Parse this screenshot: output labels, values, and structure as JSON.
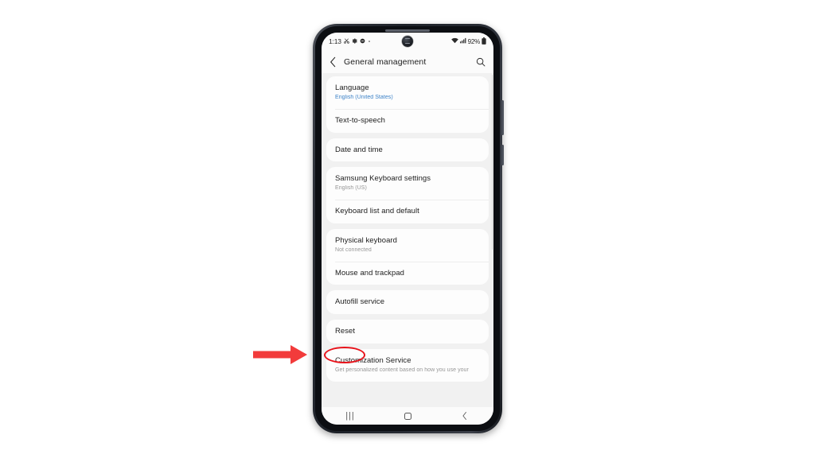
{
  "device": {
    "name": "samsung-galaxy-phone",
    "frame_color": "#2c3038"
  },
  "statusbar": {
    "clock": "1:13",
    "left_icons": [
      "scissors-icon",
      "gear-icon",
      "do-not-disturb-icon",
      "dot-icon"
    ],
    "right_icons": [
      "wifi-icon",
      "cellular-signal-icon"
    ],
    "battery_text": "92%",
    "battery_icon": "battery-full-icon"
  },
  "appbar": {
    "back_icon": "chevron-left-icon",
    "title": "General management",
    "search_icon": "search-icon"
  },
  "settings": {
    "groups": [
      {
        "rows": [
          {
            "title": "Language",
            "sub": "English (United States)",
            "sub_style": "accent"
          },
          {
            "title": "Text-to-speech",
            "sub": ""
          }
        ]
      },
      {
        "rows": [
          {
            "title": "Date and time",
            "sub": ""
          }
        ]
      },
      {
        "rows": [
          {
            "title": "Samsung Keyboard settings",
            "sub": "English (US)",
            "sub_style": "muted"
          },
          {
            "title": "Keyboard list and default",
            "sub": ""
          }
        ]
      },
      {
        "rows": [
          {
            "title": "Physical keyboard",
            "sub": "Not connected",
            "sub_style": "muted"
          },
          {
            "title": "Mouse and trackpad",
            "sub": ""
          }
        ]
      },
      {
        "rows": [
          {
            "title": "Autofill service",
            "sub": ""
          }
        ]
      },
      {
        "rows": [
          {
            "title": "Reset",
            "sub": ""
          }
        ]
      },
      {
        "rows": [
          {
            "title": "Customization Service",
            "sub": "Get personalized content based on how you use your",
            "sub_style": "muted"
          }
        ]
      }
    ]
  },
  "navbar": {
    "recents_label": "|||",
    "recents_icon": "recents-icon",
    "home_icon": "home-icon",
    "back_icon": "back-chevron-icon"
  },
  "annotation": {
    "highlight_color": "#e8121a",
    "arrow_color": "#f23b3b",
    "target": "Reset"
  }
}
